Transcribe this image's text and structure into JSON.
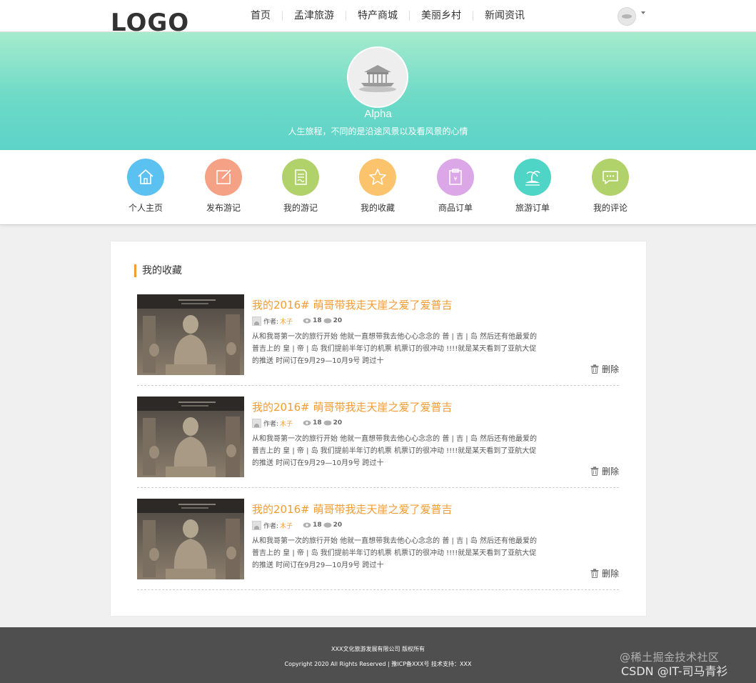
{
  "header": {
    "logo": "LOGO",
    "nav": [
      "首页",
      "孟津旅游",
      "特产商城",
      "美丽乡村",
      "新闻资讯"
    ]
  },
  "profile": {
    "name": "Alpha",
    "motto": "人生旅程，不同的是沿途风景以及看风景的心情"
  },
  "menu": [
    {
      "label": "个人主页",
      "icon": "home-icon",
      "color": "#5bc1f0"
    },
    {
      "label": "发布游记",
      "icon": "edit-icon",
      "color": "#f4a185"
    },
    {
      "label": "我的游记",
      "icon": "document-icon",
      "color": "#b1d26b"
    },
    {
      "label": "我的收藏",
      "icon": "star-icon",
      "color": "#fbc36b"
    },
    {
      "label": "商品订单",
      "icon": "order-clipboard-icon",
      "color": "#dca7e6"
    },
    {
      "label": "旅游订单",
      "icon": "island-icon",
      "color": "#4fd5c6"
    },
    {
      "label": "我的评论",
      "icon": "comment-icon",
      "color": "#b1d26b"
    }
  ],
  "favorites": {
    "title": "我的收藏",
    "author_prefix": "作者:",
    "delete_label": "删除",
    "items": [
      {
        "title": "我的2016# 萌哥带我走天崖之爱了爱普吉",
        "author": "木子",
        "views": "18",
        "comments": "20",
        "summary": "从和我哥第一次的旅行开始 他就一直想带我去他心心念念的 普 | 吉 | 岛 然后还有他最爱的普吉上的 皇 | 帝 | 岛 我们提前半年订的机票 机票订的很冲动 !!!!就是某天看到了亚航大促的推送 时间订在9月29—10月9号 跨过十"
      },
      {
        "title": "我的2016# 萌哥带我走天崖之爱了爱普吉",
        "author": "木子",
        "views": "18",
        "comments": "20",
        "summary": "从和我哥第一次的旅行开始 他就一直想带我去他心心念念的 普 | 吉 | 岛 然后还有他最爱的普吉上的 皇 | 帝 | 岛 我们提前半年订的机票 机票订的很冲动 !!!!就是某天看到了亚航大促的推送 时间订在9月29—10月9号 跨过十"
      },
      {
        "title": "我的2016# 萌哥带我走天崖之爱了爱普吉",
        "author": "木子",
        "views": "18",
        "comments": "20",
        "summary": "从和我哥第一次的旅行开始 他就一直想带我去他心心念念的 普 | 吉 | 岛 然后还有他最爱的普吉上的 皇 | 帝 | 岛 我们提前半年订的机票 机票订的很冲动 !!!!就是某天看到了亚航大促的推送 时间订在9月29—10月9号 跨过十"
      }
    ]
  },
  "footer": {
    "company": "XXX文化旅游发展有限公司 版权所有",
    "copyright": "Copyright 2020 All Rights Reserved | 豫ICP备XXX号    技术支持：XXX"
  },
  "watermark": {
    "line1": "@稀土掘金技术社区",
    "line2": "CSDN @IT-司马青衫"
  },
  "colors": {
    "accent": "#f39c34",
    "banner_top": "#a6ebcd",
    "banner_bottom": "#5dd3c8",
    "footer": "#4f4f4f"
  }
}
